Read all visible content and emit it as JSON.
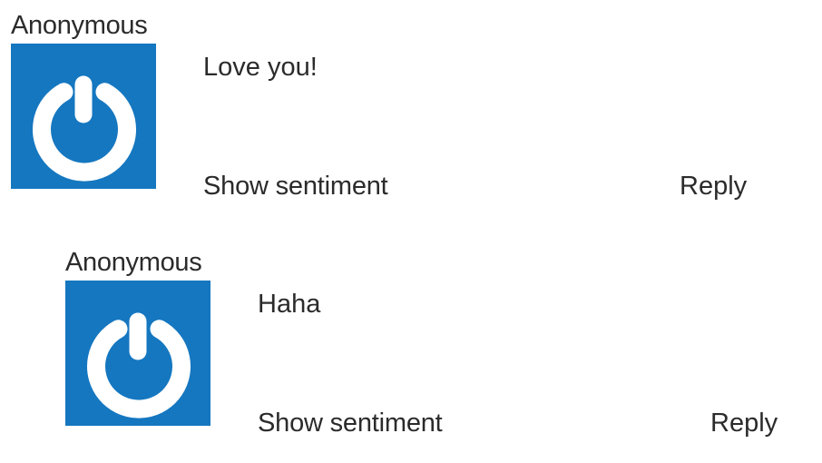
{
  "colors": {
    "avatar_background": "#1577c0",
    "avatar_glyph": "#ffffff",
    "text": "#2b2b2b"
  },
  "comments": [
    {
      "author": "Anonymous",
      "avatar_icon": "power-icon",
      "text": "Love you!",
      "show_sentiment_label": "Show sentiment",
      "reply_label": "Reply"
    },
    {
      "author": "Anonymous",
      "avatar_icon": "power-icon",
      "text": "Haha",
      "show_sentiment_label": "Show sentiment",
      "reply_label": "Reply"
    }
  ]
}
